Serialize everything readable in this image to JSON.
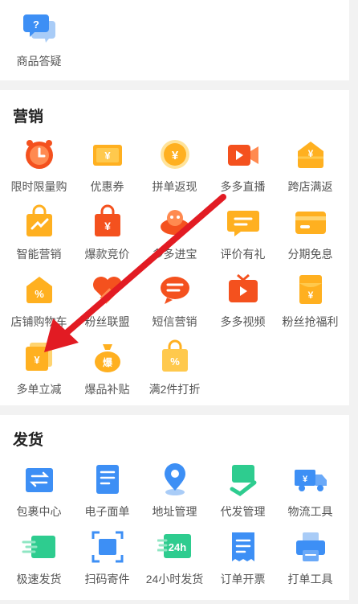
{
  "top": {
    "item_label": "商品答疑"
  },
  "marketing": {
    "title": "营销",
    "items": [
      {
        "label": "限时限量购",
        "icon": "clock-icon"
      },
      {
        "label": "优惠券",
        "icon": "coupon-icon"
      },
      {
        "label": "拼单返现",
        "icon": "cashback-coin-icon"
      },
      {
        "label": "多多直播",
        "icon": "live-camera-icon"
      },
      {
        "label": "跨店满返",
        "icon": "cross-store-tag-icon"
      },
      {
        "label": "智能营销",
        "icon": "smart-bag-icon"
      },
      {
        "label": "爆款竞价",
        "icon": "bid-bag-icon"
      },
      {
        "label": "多多进宝",
        "icon": "treasure-icon"
      },
      {
        "label": "评价有礼",
        "icon": "review-bubble-icon"
      },
      {
        "label": "分期免息",
        "icon": "credit-card-icon"
      },
      {
        "label": "店铺购物车",
        "icon": "store-cart-tag-icon"
      },
      {
        "label": "粉丝联盟",
        "icon": "fan-heart-icon"
      },
      {
        "label": "短信营销",
        "icon": "sms-bubble-icon"
      },
      {
        "label": "多多视频",
        "icon": "tv-play-icon"
      },
      {
        "label": "粉丝抢福利",
        "icon": "red-envelope-icon"
      },
      {
        "label": "多单立减",
        "icon": "multi-order-discount-icon"
      },
      {
        "label": "爆品补贴",
        "icon": "money-bag-icon"
      },
      {
        "label": "满2件打折",
        "icon": "discount-bag-icon"
      }
    ]
  },
  "shipping": {
    "title": "发货",
    "items": [
      {
        "label": "包裹中心",
        "icon": "package-center-icon"
      },
      {
        "label": "电子面单",
        "icon": "e-waybill-icon"
      },
      {
        "label": "地址管理",
        "icon": "location-pin-icon"
      },
      {
        "label": "代发管理",
        "icon": "dropship-box-icon"
      },
      {
        "label": "物流工具",
        "icon": "truck-icon"
      },
      {
        "label": "极速发货",
        "icon": "fast-ship-icon"
      },
      {
        "label": "扫码寄件",
        "icon": "scan-code-icon"
      },
      {
        "label": "24小时发货",
        "icon": "24h-icon"
      },
      {
        "label": "订单开票",
        "icon": "invoice-icon"
      },
      {
        "label": "打单工具",
        "icon": "printer-icon"
      }
    ]
  },
  "colors": {
    "orange": "#ff9a1f",
    "red": "#f4511e",
    "blue": "#3d8ff5",
    "green": "#2ecc8f",
    "arrow": "#e21b23"
  }
}
